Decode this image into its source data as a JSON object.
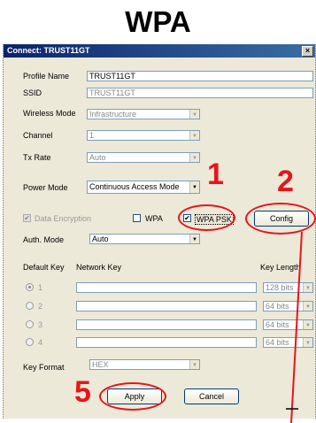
{
  "heading": "WPA",
  "window": {
    "title": "Connect: TRUST11GT",
    "close_glyph": "×"
  },
  "profile_name": {
    "label": "Profile Name",
    "value": "TRUST11GT"
  },
  "ssid": {
    "label": "SSID",
    "value": "TRUST11GT"
  },
  "wireless_mode": {
    "label": "Wireless Mode",
    "value": "Infrastructure"
  },
  "channel": {
    "label": "Channel",
    "value": "1"
  },
  "tx_rate": {
    "label": "Tx Rate",
    "value": "Auto"
  },
  "power_mode": {
    "label": "Power Mode",
    "value": "Continuous Access Mode"
  },
  "data_encryption": {
    "label": "Data Encryption",
    "checked": true
  },
  "wpa": {
    "label": "WPA",
    "checked": false
  },
  "wpa_psk": {
    "label": "WPA PSK",
    "checked": true
  },
  "config_button": "Config",
  "auth_mode": {
    "label": "Auth. Mode",
    "value": "Auto"
  },
  "keys": {
    "default_key_label": "Default Key",
    "network_key_label": "Network Key",
    "key_length_label": "Key Length",
    "rows": [
      {
        "num": "1",
        "value": "",
        "length": "128 bits",
        "selected": true
      },
      {
        "num": "2",
        "value": "",
        "length": "64 bits",
        "selected": false
      },
      {
        "num": "3",
        "value": "",
        "length": "64 bits",
        "selected": false
      },
      {
        "num": "4",
        "value": "",
        "length": "64 bits",
        "selected": false
      }
    ]
  },
  "key_format": {
    "label": "Key Format",
    "value": "HEX"
  },
  "apply_button": "Apply",
  "cancel_button": "Cancel",
  "annotations": {
    "step1": "1",
    "step2": "2",
    "step5": "5",
    "color": "#e8141c"
  },
  "icons": {
    "dropdown": "▼",
    "check": "✔"
  }
}
